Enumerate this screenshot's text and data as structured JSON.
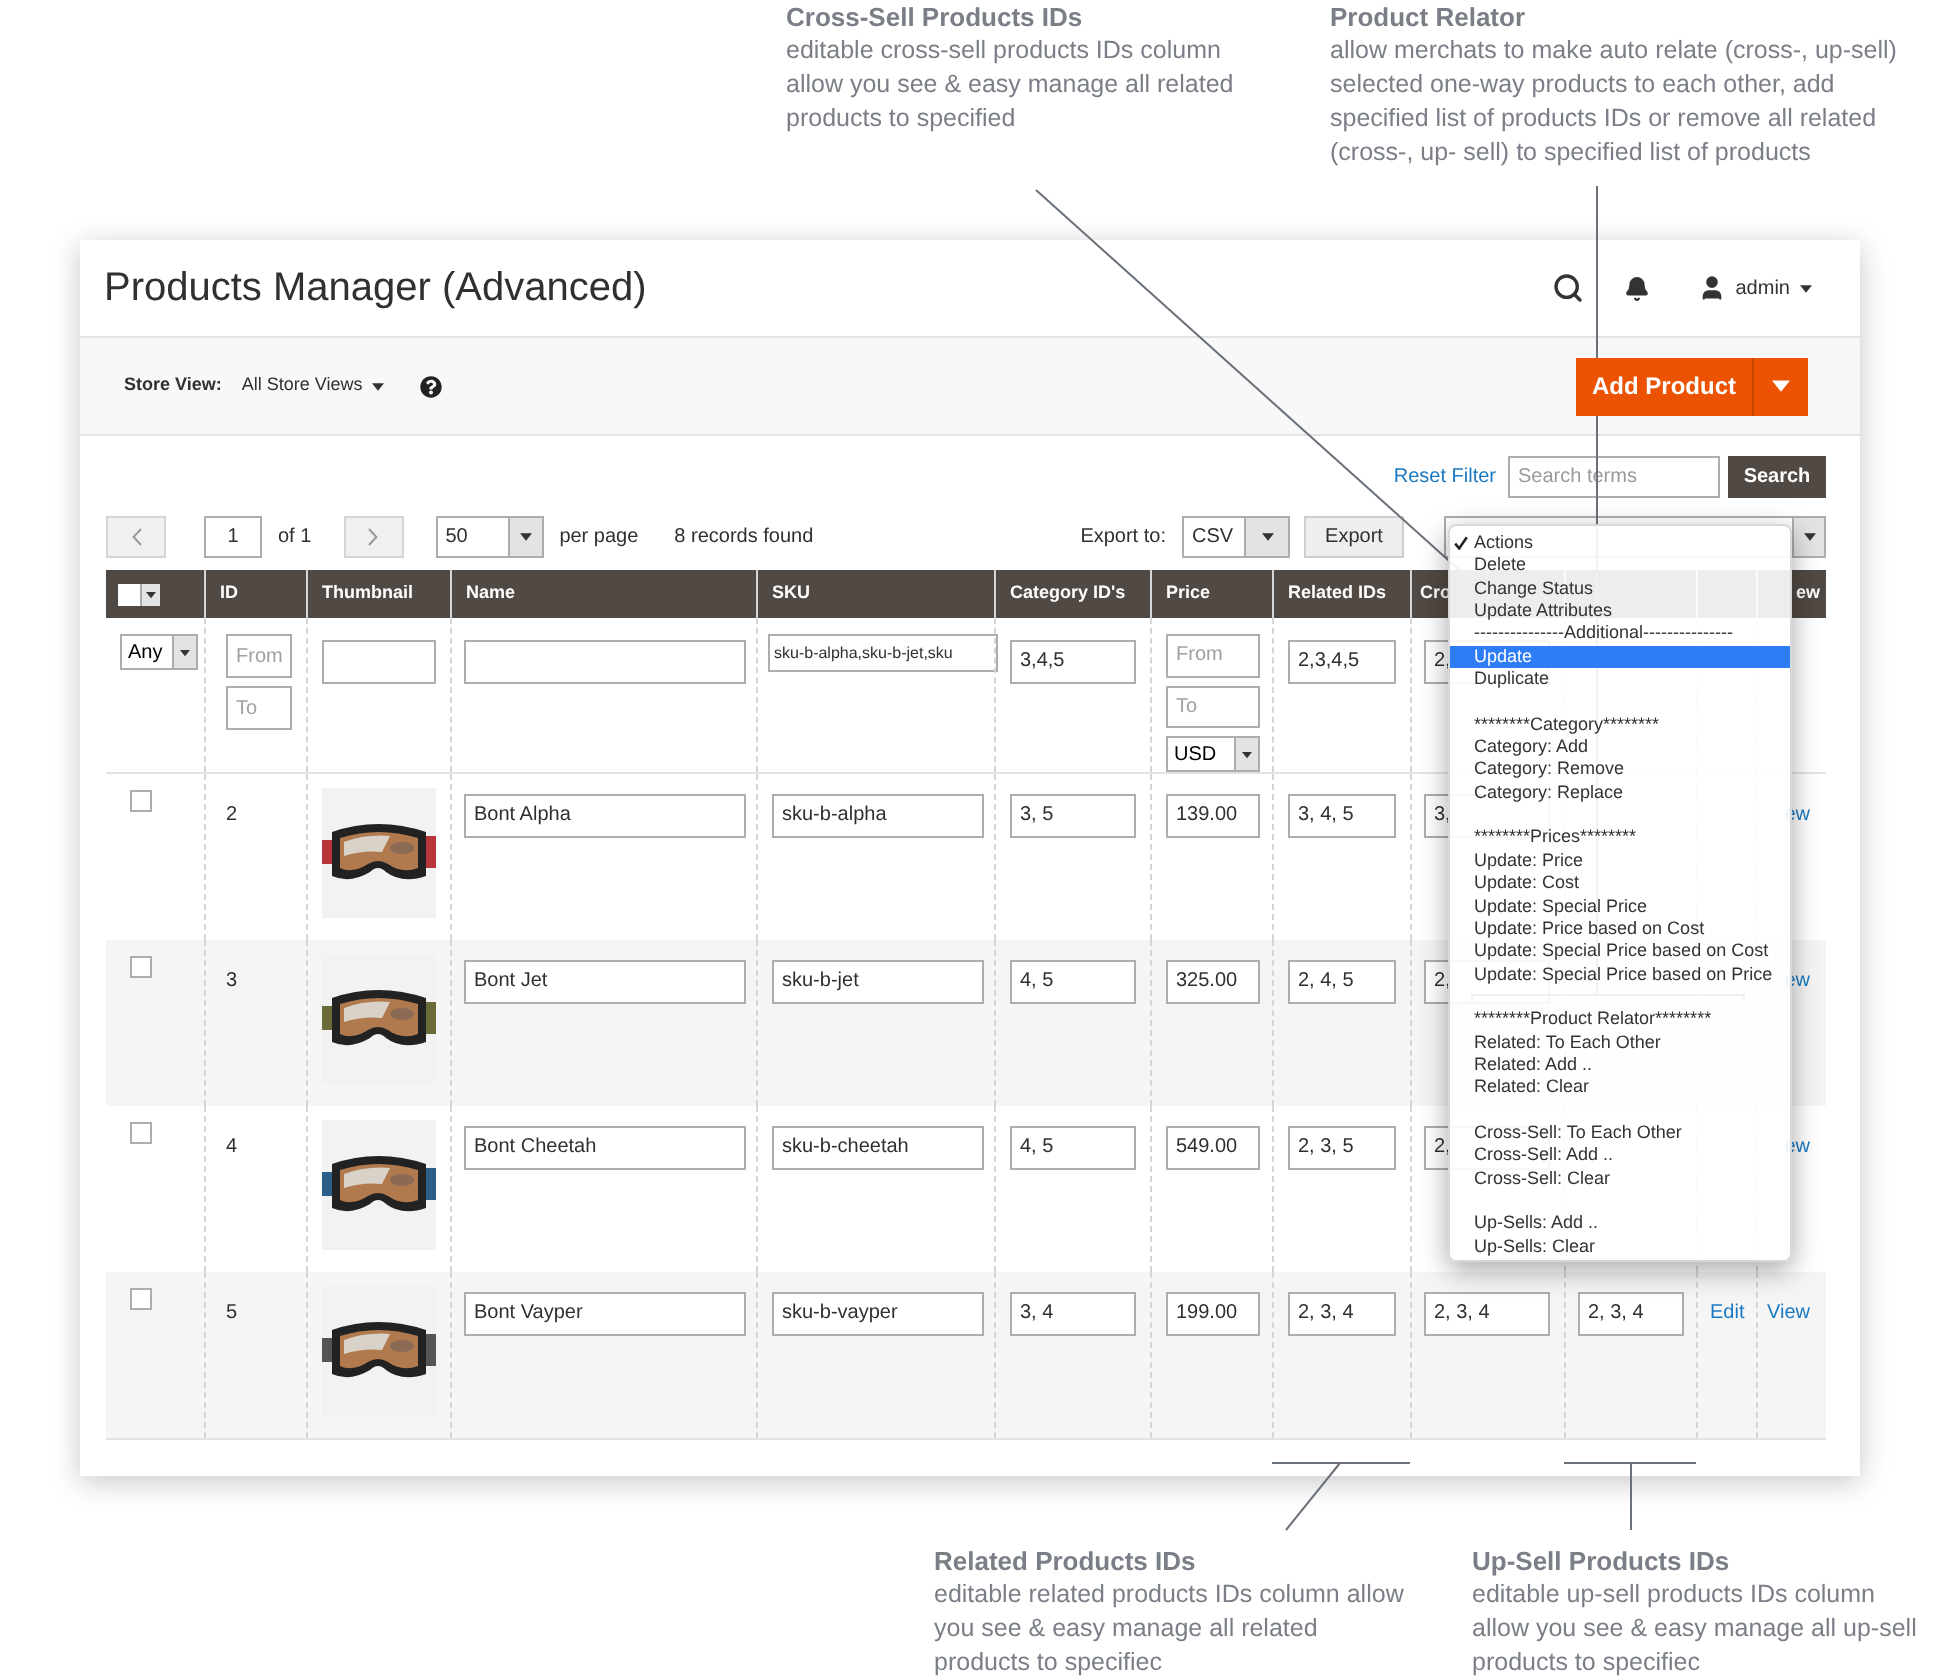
{
  "annotations_top": [
    {
      "title": "Cross-Sell Products IDs",
      "text": "editable cross-sell products IDs column allow you see & easy manage all related products to specified"
    },
    {
      "title": "Product Relator",
      "text": "allow merchats to make auto relate (cross-, up-sell) selected one-way products to each other, add specified list of products IDs or remove all related (cross-, up- sell) to specified list of products"
    }
  ],
  "header": {
    "title": "Products Manager (Advanced)",
    "user": "admin"
  },
  "store_bar": {
    "label": "Store View:",
    "value": "All Store Views",
    "button": "Add Product"
  },
  "search": {
    "reset": "Reset Filter",
    "placeholder": "Search terms",
    "button": "Search"
  },
  "pager": {
    "page": "1",
    "of": "of 1",
    "per_page": "50",
    "per_page_label": "per page",
    "records": "8 records found",
    "export_label": "Export to:",
    "export_format": "CSV",
    "export_button": "Export"
  },
  "table": {
    "columns": [
      "ID",
      "Thumbnail",
      "Name",
      "SKU",
      "Category ID's",
      "Price",
      "Related IDs",
      "Cro",
      "ew"
    ],
    "select_all": {
      "checked": false
    },
    "filters": {
      "status": "Any",
      "id_from": {
        "placeholder": "From"
      },
      "id_to": {
        "placeholder": "To"
      },
      "sku": "sku-b-alpha,sku-b-jet,sku",
      "categories": "3,4,5",
      "price_from": {
        "placeholder": "From"
      },
      "price_to": {
        "placeholder": "To"
      },
      "currency": "USD",
      "related": "2,3,4,5",
      "cross_sell": "2,"
    },
    "rows": [
      {
        "checked": false,
        "id": "2",
        "name": "Bont Alpha",
        "sku": "sku-b-alpha",
        "categories": "3, 5",
        "price": "139.00",
        "related": "3, 4, 5",
        "cross_sell": "3,",
        "view": "ew"
      },
      {
        "checked": false,
        "id": "3",
        "name": "Bont Jet",
        "sku": "sku-b-jet",
        "categories": "4, 5",
        "price": "325.00",
        "related": "2, 4, 5",
        "cross_sell": "2,",
        "view": "ew"
      },
      {
        "checked": false,
        "id": "4",
        "name": "Bont Cheetah",
        "sku": "sku-b-cheetah",
        "categories": "4, 5",
        "price": "549.00",
        "related": "2, 3, 5",
        "cross_sell": "2,",
        "view": "ew"
      },
      {
        "checked": false,
        "id": "5",
        "name": "Bont Vayper",
        "sku": "sku-b-vayper",
        "categories": "3, 4",
        "price": "199.00",
        "related": "2, 3, 4",
        "cross_sell": "2, 3, 4",
        "up_sell": "2, 3, 4",
        "edit": "Edit",
        "view": "View"
      }
    ]
  },
  "actions_menu": {
    "items": [
      {
        "kind": "option",
        "label": "Actions",
        "selected": true,
        "highlighted": false
      },
      {
        "kind": "option",
        "label": "Delete",
        "selected": false,
        "highlighted": false
      },
      {
        "kind": "option",
        "label": "Change Status",
        "selected": false,
        "highlighted": false
      },
      {
        "kind": "option",
        "label": "Update Attributes",
        "selected": false,
        "highlighted": false
      },
      {
        "kind": "heading",
        "label": "---------------Additional---------------"
      },
      {
        "kind": "option",
        "label": "Update",
        "selected": false,
        "highlighted": true
      },
      {
        "kind": "option",
        "label": "Duplicate",
        "selected": false,
        "highlighted": false
      },
      {
        "kind": "gap"
      },
      {
        "kind": "heading",
        "label": "********Category********"
      },
      {
        "kind": "option",
        "label": "Category: Add",
        "selected": false,
        "highlighted": false
      },
      {
        "kind": "option",
        "label": "Category: Remove",
        "selected": false,
        "highlighted": false
      },
      {
        "kind": "option",
        "label": "Category: Replace",
        "selected": false,
        "highlighted": false
      },
      {
        "kind": "gap"
      },
      {
        "kind": "heading",
        "label": "********Prices********"
      },
      {
        "kind": "option",
        "label": "Update: Price",
        "selected": false,
        "highlighted": false
      },
      {
        "kind": "option",
        "label": "Update: Cost",
        "selected": false,
        "highlighted": false
      },
      {
        "kind": "option",
        "label": "Update: Special Price",
        "selected": false,
        "highlighted": false
      },
      {
        "kind": "option",
        "label": "Update: Price based on Cost",
        "selected": false,
        "highlighted": false
      },
      {
        "kind": "option",
        "label": "Update: Special Price based on Cost",
        "selected": false,
        "highlighted": false
      },
      {
        "kind": "option",
        "label": "Update: Special Price based on Price",
        "selected": false,
        "highlighted": false
      },
      {
        "kind": "gap"
      },
      {
        "kind": "heading",
        "label": "********Product Relator********"
      },
      {
        "kind": "option",
        "label": "Related: To Each Other",
        "selected": false,
        "highlighted": false
      },
      {
        "kind": "option",
        "label": "Related: Add ..",
        "selected": false,
        "highlighted": false
      },
      {
        "kind": "option",
        "label": "Related: Clear",
        "selected": false,
        "highlighted": false
      },
      {
        "kind": "gap"
      },
      {
        "kind": "option",
        "label": "Cross-Sell: To Each Other",
        "selected": false,
        "highlighted": false
      },
      {
        "kind": "option",
        "label": "Cross-Sell: Add ..",
        "selected": false,
        "highlighted": false
      },
      {
        "kind": "option",
        "label": "Cross-Sell: Clear",
        "selected": false,
        "highlighted": false
      },
      {
        "kind": "gap"
      },
      {
        "kind": "option",
        "label": "Up-Sells: Add ..",
        "selected": false,
        "highlighted": false
      },
      {
        "kind": "option",
        "label": "Up-Sells: Clear",
        "selected": false,
        "highlighted": false
      }
    ]
  },
  "annotations_bottom": [
    {
      "title": "Related Products IDs",
      "text": "editable related products IDs column allow you see & easy manage all related products to specifiec"
    },
    {
      "title": "Up-Sell Products IDs",
      "text": "editable up-sell products IDs column allow you see & easy manage all up-sell products to specifiec"
    }
  ]
}
